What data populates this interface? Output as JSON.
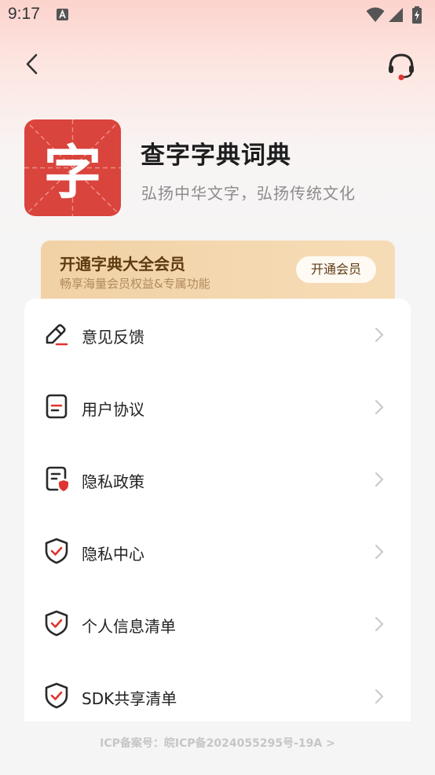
{
  "status_bar": {
    "time": "9:17"
  },
  "app": {
    "logo_char": "字",
    "name": "查字字典词典",
    "slogan": "弘扬中华文字，弘扬传统文化"
  },
  "vip": {
    "title": "开通字典大全会员",
    "subtitle": "畅享海量会员权益&专属功能",
    "button_label": "开通会员",
    "colors": {
      "start": "#f1d1a5",
      "end": "#f6dcb6",
      "text": "#5e3a11"
    }
  },
  "menu": {
    "items": [
      {
        "label": "意见反馈",
        "icon": "edit-feedback-icon"
      },
      {
        "label": "用户协议",
        "icon": "document-icon"
      },
      {
        "label": "隐私政策",
        "icon": "document-shield-icon"
      },
      {
        "label": "隐私中心",
        "icon": "shield-check-icon"
      },
      {
        "label": "个人信息清单",
        "icon": "shield-check-icon"
      },
      {
        "label": "SDK共享清单",
        "icon": "shield-check-icon"
      }
    ]
  },
  "icp": "ICP备案号：皖ICP备2024055295号-19A >",
  "colors": {
    "accent": "#e0342f",
    "logo_bg": "#d9443c"
  }
}
